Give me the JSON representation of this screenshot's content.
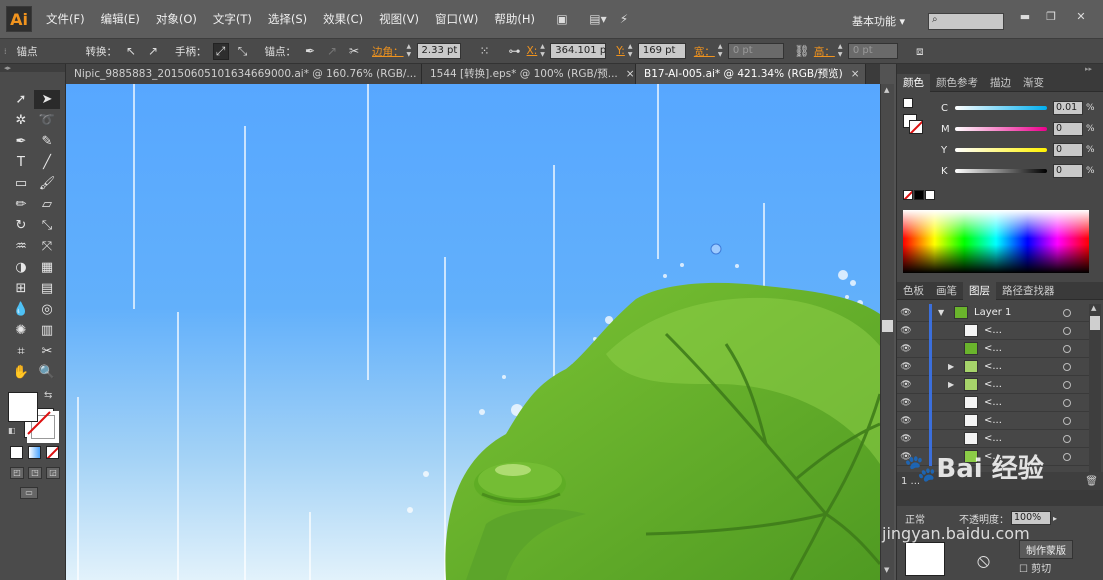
{
  "app": {
    "logo": "Ai"
  },
  "menu": [
    "文件(F)",
    "编辑(E)",
    "对象(O)",
    "文字(T)",
    "选择(S)",
    "效果(C)",
    "视图(V)",
    "窗口(W)",
    "帮助(H)"
  ],
  "menu_icons": [
    "bridge-icon",
    "arrange-documents-icon",
    "gpu-performance-icon"
  ],
  "workspace": {
    "label": "基本功能",
    "arrow": "▾"
  },
  "window_controls": {
    "minimize": "▬",
    "restore": "❐",
    "close": "✕"
  },
  "control_bar": {
    "selection_label": "锚点",
    "convert_label": "转换：",
    "handles_label": "手柄：",
    "anchors_label": "锚点：",
    "corner_label": "边角：",
    "corner_value": "2.33 pt",
    "x_label": "X:",
    "x_value": "364.101 p",
    "y_label": "Y:",
    "y_value": "169 pt",
    "w_label": "宽：",
    "w_value": "0 pt",
    "h_label": "高：",
    "h_value": "0 pt"
  },
  "tabs": [
    {
      "label": "Nipic_9885883_20150605101634669000.ai* @ 160.76% (RGB/...",
      "close": "×",
      "active": false
    },
    {
      "label": "1544 [转换].eps* @ 100% (RGB/预...",
      "close": "×",
      "active": false
    },
    {
      "label": "B17-AI-005.ai* @ 421.34% (RGB/预览)",
      "close": "×",
      "active": true
    }
  ],
  "color_panel": {
    "tabs": [
      "颜色",
      "颜色参考",
      "描边",
      "渐变"
    ],
    "channels": [
      {
        "label": "C",
        "value": "0.01"
      },
      {
        "label": "M",
        "value": "0"
      },
      {
        "label": "Y",
        "value": "0"
      },
      {
        "label": "K",
        "value": "0"
      }
    ],
    "unit": "%"
  },
  "layers_panel": {
    "tabs": [
      "色板",
      "画笔",
      "图层",
      "路径查找器"
    ],
    "layer_name": "Layer 1",
    "sublayer_label": "<...",
    "count_text": "1 ...",
    "sublayers": 8
  },
  "transparency": {
    "mode": "正常",
    "opacity_label": "不透明度：",
    "opacity_value": "100%",
    "make_mask": "制作蒙版",
    "clip": "剪切"
  },
  "watermark": {
    "text": "Bai 经验",
    "url": "jingyan.baidu.com"
  },
  "colors": {
    "accent_orange": "#f0931e",
    "sky_top": "#57a7ff",
    "leaf_green": "#6ab42c",
    "layer_blue": "#3b6fdc"
  }
}
